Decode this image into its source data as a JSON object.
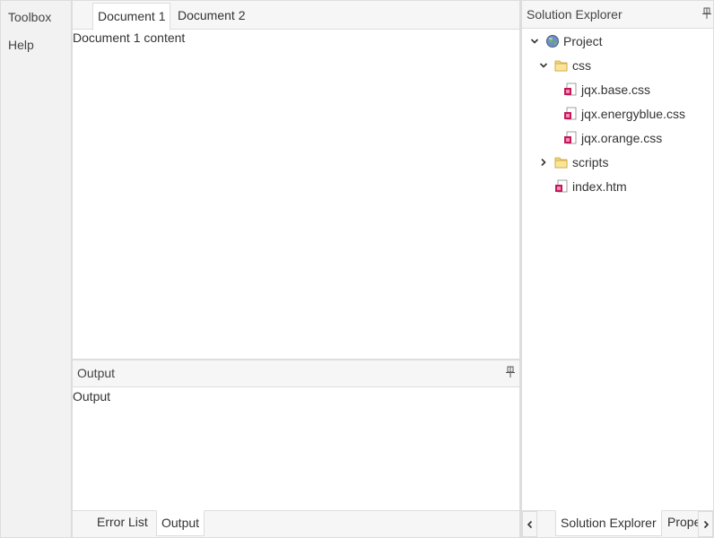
{
  "toolbox": {
    "items": [
      "Toolbox",
      "Help"
    ]
  },
  "documents": {
    "tabs": [
      "Document 1",
      "Document 2"
    ],
    "active_content": "Document 1 content"
  },
  "output": {
    "title": "Output",
    "content": "Output",
    "tabs": [
      "Error List",
      "Output"
    ]
  },
  "solution": {
    "title": "Solution Explorer",
    "tree": {
      "project": "Project",
      "css_folder": "css",
      "css_files": [
        "jqx.base.css",
        "jqx.energyblue.css",
        "jqx.orange.css"
      ],
      "scripts_folder": "scripts",
      "index_file": "index.htm"
    },
    "tabs": [
      "Solution Explorer",
      "Properties"
    ]
  },
  "icons": {
    "pin": "pin-icon",
    "expanded": "chevron-down-icon",
    "collapsed": "chevron-right-icon",
    "project": "globe-icon",
    "folder": "folder-icon",
    "file": "file-icon",
    "scroll_left": "chevron-left-icon",
    "scroll_right": "chevron-right-icon"
  },
  "colors": {
    "folder": "#f5d774",
    "file_accent": "#c2185b",
    "border": "#dddddd",
    "panel_background": "#f6f6f6"
  }
}
